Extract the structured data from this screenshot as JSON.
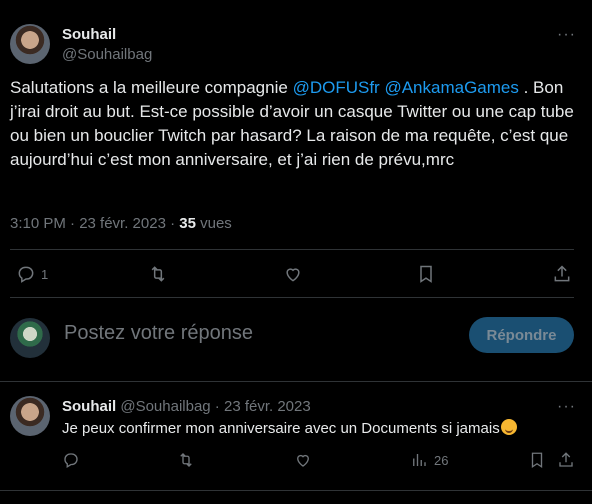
{
  "tweet": {
    "author_name": "Souhail",
    "author_handle": "@Souhailbag",
    "more": "···",
    "text_part1": "Salutations a la meilleure compagnie ",
    "mention1": "@DOFUSfr",
    "mention2": "@AnkamaGames",
    "text_part2": "  . Bon j’irai droit au but. Est-ce possible d’avoir un casque Twitter ou une cap tube ou bien un bouclier Twitch par hasard? La raison de ma requête, c’est que aujourd’hui c’est mon anniversaire, et j’ai rien de prévu,mrc",
    "time": "3:10 PM · 23 févr. 2023 · ",
    "views_count": "35",
    "views_label": " vues",
    "reply_count": "1"
  },
  "composer": {
    "placeholder": "Postez votre réponse",
    "button_label": "Répondre"
  },
  "comment": {
    "author_name": "Souhail",
    "author_handle": "@Souhailbag",
    "date": " · 23 févr. 2023",
    "more": "···",
    "text": "Je peux confirmer mon anniversaire avec un Documents si jamais",
    "views_count": "26"
  },
  "colors": {
    "background": "#000000",
    "link": "#1d9bf0",
    "muted": "#71767b",
    "button": "#1a4f72"
  }
}
